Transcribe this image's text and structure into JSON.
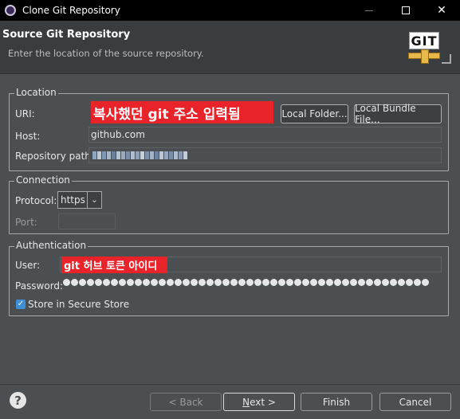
{
  "window": {
    "title": "Clone Git Repository",
    "minimize_icon": "minimize-icon",
    "maximize_icon": "maximize-icon",
    "close_icon": "close-icon"
  },
  "header": {
    "title": "Source Git Repository",
    "description": "Enter the location of the source repository.",
    "logo_text": "GIT"
  },
  "location": {
    "legend": "Location",
    "uri_label": "URI:",
    "uri_annotation": "복사했던 git 주소 입력됨",
    "local_folder_button": "Local Folder...",
    "local_bundle_button": "Local Bundle File...",
    "host_label": "Host:",
    "host_value": "github.com",
    "repo_path_label": "Repository path:"
  },
  "connection": {
    "legend": "Connection",
    "protocol_label": "Protocol:",
    "protocol_value": "https",
    "port_label": "Port:",
    "port_value": ""
  },
  "authentication": {
    "legend": "Authentication",
    "user_label": "User:",
    "user_annotation": "git 허브 토큰 아이디",
    "password_label": "Password:",
    "store_label": "Store in Secure Store",
    "store_checked": true
  },
  "footer": {
    "help_icon": "help-icon",
    "back_button": "< Back",
    "next_button_prefix": "N",
    "next_button_rest": "ext >",
    "finish_button": "Finish",
    "cancel_button": "Cancel"
  },
  "colors": {
    "annotation_red": "#e8232a",
    "checkbox_blue": "#3d8fd8",
    "background": "#4b4f52"
  }
}
